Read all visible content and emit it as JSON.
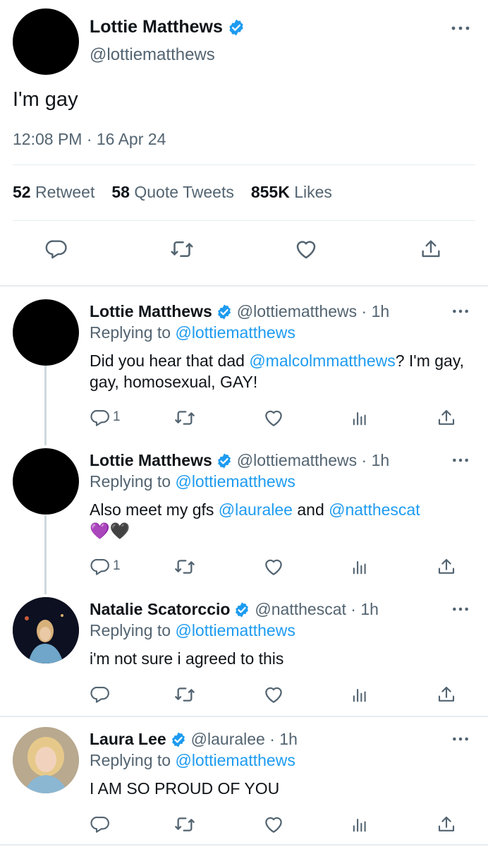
{
  "main_tweet": {
    "name": "Lottie Matthews",
    "handle": "@lottiematthews",
    "text": "I'm gay",
    "timestamp": "12:08 PM · 16 Apr 24",
    "stats": {
      "retweets_count": "52",
      "retweets_label": "Retweet",
      "quotes_count": "58",
      "quotes_label": "Quote Tweets",
      "likes_count": "855K",
      "likes_label": "Likes"
    }
  },
  "replies": [
    {
      "name": "Lottie Matthews",
      "handle": "@lottiematthews",
      "sep": " · ",
      "time": "1h",
      "replying_prefix": "Replying to ",
      "replying_to": "@lottiematthews",
      "text_1": "Did you hear that dad ",
      "mention_1": "@malcolmmatthews",
      "text_2": "? I'm gay, gay, homosexual, GAY!",
      "reply_count": "1"
    },
    {
      "name": "Lottie Matthews",
      "handle": "@lottiematthews",
      "sep": " · ",
      "time": "1h",
      "replying_prefix": "Replying to ",
      "replying_to": "@lottiematthews",
      "text_1": "Also meet my gfs ",
      "mention_1": "@lauralee",
      "text_2": " and ",
      "mention_2": "@natthescat",
      "emoji": "💜🖤",
      "reply_count": "1"
    },
    {
      "name": "Natalie Scatorccio",
      "handle": "@natthescat",
      "sep": " · ",
      "time": "1h",
      "replying_prefix": "Replying to ",
      "replying_to": "@lottiematthews",
      "text_1": "i'm not sure i agreed to this",
      "reply_count": ""
    },
    {
      "name": "Laura Lee",
      "handle": "@lauralee",
      "sep": " · ",
      "time": "1h",
      "replying_prefix": "Replying to ",
      "replying_to": "@lottiematthews",
      "text_1": "I AM SO PROUD OF YOU",
      "reply_count": ""
    }
  ],
  "colors": {
    "link": "#1d9bf0",
    "secondary_text": "#536471",
    "verified": "#1d9bf0",
    "divider": "#e6ecf0",
    "thread_line": "#cfd9de"
  },
  "icons": [
    "verified-badge-icon",
    "more-icon",
    "reply-icon",
    "retweet-icon",
    "like-icon",
    "analytics-icon",
    "share-icon"
  ]
}
